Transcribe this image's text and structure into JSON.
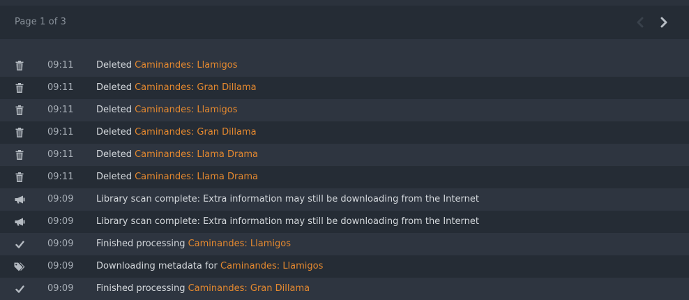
{
  "pager": {
    "label": "Page 1 of 3",
    "prev_icon": "chevron-left-icon",
    "next_icon": "chevron-right-icon"
  },
  "colors": {
    "link": "#e5892f",
    "text": "#d3d7db",
    "muted": "#a7aeb6"
  },
  "activity": [
    {
      "icon": "trash-icon",
      "time": "09:11",
      "text": "Deleted ",
      "link": "Caminandes: Llamigos"
    },
    {
      "icon": "trash-icon",
      "time": "09:11",
      "text": "Deleted ",
      "link": "Caminandes: Gran Dillama"
    },
    {
      "icon": "trash-icon",
      "time": "09:11",
      "text": "Deleted ",
      "link": "Caminandes: Llamigos"
    },
    {
      "icon": "trash-icon",
      "time": "09:11",
      "text": "Deleted ",
      "link": "Caminandes: Gran Dillama"
    },
    {
      "icon": "trash-icon",
      "time": "09:11",
      "text": "Deleted ",
      "link": "Caminandes: Llama Drama"
    },
    {
      "icon": "trash-icon",
      "time": "09:11",
      "text": "Deleted ",
      "link": "Caminandes: Llama Drama"
    },
    {
      "icon": "megaphone-icon",
      "time": "09:09",
      "text": "Library scan complete: Extra information may still be downloading from the Internet",
      "link": ""
    },
    {
      "icon": "megaphone-icon",
      "time": "09:09",
      "text": "Library scan complete: Extra information may still be downloading from the Internet",
      "link": ""
    },
    {
      "icon": "checkmark-icon",
      "time": "09:09",
      "text": "Finished processing ",
      "link": "Caminandes: Llamigos"
    },
    {
      "icon": "tags-icon",
      "time": "09:09",
      "text": "Downloading metadata for ",
      "link": "Caminandes: Llamigos"
    },
    {
      "icon": "checkmark-icon",
      "time": "09:09",
      "text": "Finished processing ",
      "link": "Caminandes: Gran Dillama"
    }
  ]
}
